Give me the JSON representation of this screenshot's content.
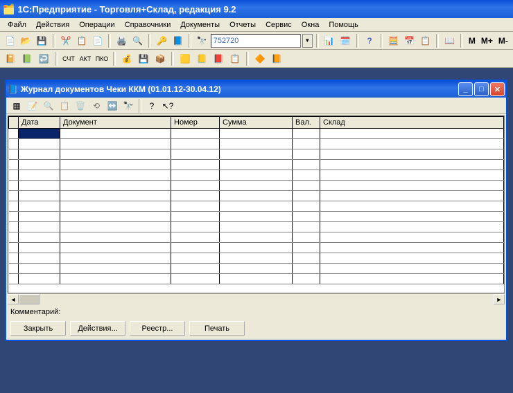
{
  "app": {
    "title": "1С:Предприятие - Торговля+Склад, редакция 9.2"
  },
  "menu": [
    "Файл",
    "Действия",
    "Операции",
    "Справочники",
    "Документы",
    "Отчеты",
    "Сервис",
    "Окна",
    "Помощь"
  ],
  "toolbar1": {
    "search_value": "752720"
  },
  "mtext": {
    "m": "M",
    "mplus": "M+",
    "mminus": "M-"
  },
  "child": {
    "title": "Журнал документов  Чеки ККМ (01.01.12-30.04.12)",
    "columns": [
      "",
      "Дата",
      "Документ",
      "Номер",
      "Сумма",
      "Вал.",
      "Склад"
    ],
    "comment_label": "Комментарий:",
    "buttons": {
      "close": "Закрыть",
      "actions": "Действия...",
      "registry": "Реестр...",
      "print": "Печать"
    }
  }
}
